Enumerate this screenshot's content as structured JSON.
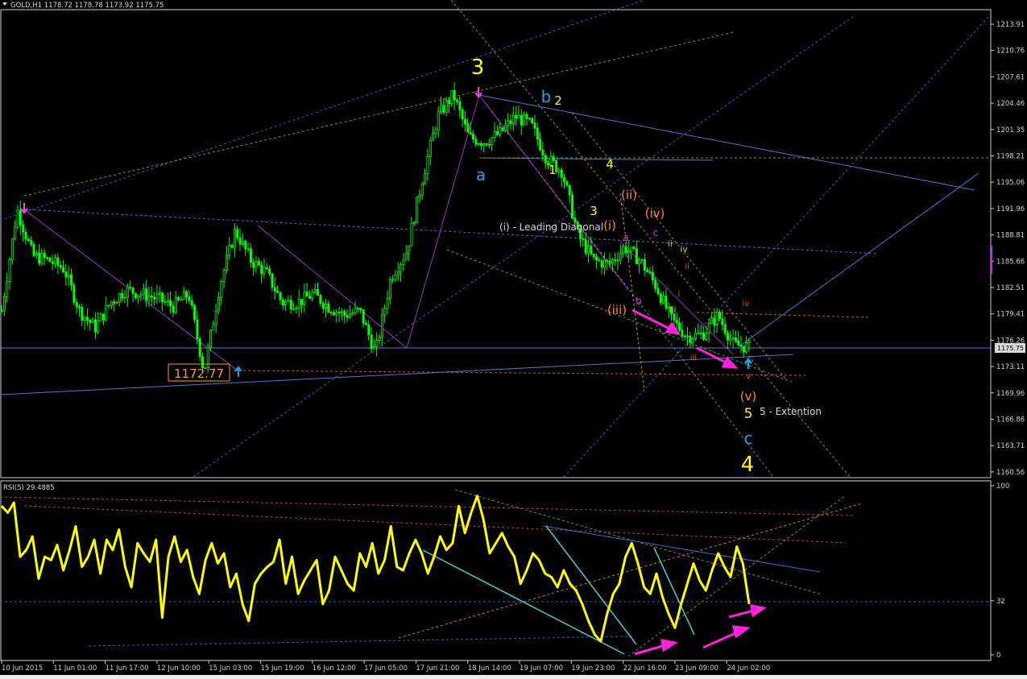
{
  "main_panel": {
    "header": "GOLD,H1  1178.72 1178.78 1173.92 1175.75",
    "price_ticks": [
      "1213.91",
      "1210.76",
      "1207.61",
      "1204.46",
      "1201.35",
      "1198.21",
      "1195.06",
      "1191.96",
      "1188.81",
      "1185.66",
      "1182.51",
      "1179.41",
      "1176.26",
      "1173.11",
      "1169.96",
      "1166.86",
      "1163.71",
      "1160.56"
    ],
    "current_price_tag": "1175.75",
    "low_price_label": "1172.77",
    "wave_labels": [
      {
        "text": "3",
        "color": "#ffff00"
      },
      {
        "text": "4",
        "color": "#ffff00"
      },
      {
        "text": "5",
        "color": "#ffff00"
      },
      {
        "text": "b",
        "color": "#19a4f0"
      },
      {
        "text": "a",
        "color": "#19a4f0"
      },
      {
        "text": "c",
        "color": "#19a4f0"
      },
      {
        "text": "2",
        "color": "#ffff00"
      },
      {
        "text": "1",
        "color": "#ffff00"
      },
      {
        "text": "4",
        "color": "#ffff00"
      },
      {
        "text": "3",
        "color": "#ffff00"
      },
      {
        "text": "(ii)",
        "color": "#ff8c00"
      },
      {
        "text": "(iv)",
        "color": "#ff8c00"
      },
      {
        "text": "(i)",
        "color": "#ff8c00"
      },
      {
        "text": "(iii)",
        "color": "#ff8c00"
      },
      {
        "text": "(v)",
        "color": "#ff8c00"
      },
      {
        "text": "(i) - Leading Diagonal",
        "color": "#d8d8d8"
      },
      {
        "text": "5 - Extention",
        "color": "#d8d8d8"
      },
      {
        "text": "a",
        "color": "#c83cc8"
      },
      {
        "text": "b",
        "color": "#c83cc8"
      },
      {
        "text": "c",
        "color": "#c83cc8"
      },
      {
        "text": "ii",
        "color": "#b5d82a"
      },
      {
        "text": "iv",
        "color": "#b5d82a"
      },
      {
        "text": "iii",
        "color": "#b5d82a"
      },
      {
        "text": "i",
        "color": "#ff4040"
      },
      {
        "text": "ii",
        "color": "#ff4040"
      },
      {
        "text": "iii",
        "color": "#ff4040"
      },
      {
        "text": "iv",
        "color": "#ff4040"
      },
      {
        "text": "v",
        "color": "#ff4040"
      }
    ]
  },
  "rsi_panel": {
    "header": "RSI(5) 29.4885",
    "ticks": [
      "100",
      "32",
      "0"
    ]
  },
  "x_ticks": [
    "10 Jun 2015",
    "11 Jun 01:00",
    "11 Jun 17:00",
    "12 Jun 10:00",
    "15 Jun 03:00",
    "15 Jun 19:00",
    "16 Jun 12:00",
    "17 Jun 05:00",
    "17 Jun 21:00",
    "18 Jun 14:00",
    "19 Jun 07:00",
    "19 Jun 23:00",
    "22 Jun 16:00",
    "23 Jun 09:00",
    "24 Jun 02:00"
  ],
  "colors": {
    "background": "#000000",
    "candle_up": "#00ff00",
    "candle_down": "#00ff00",
    "rsi_line": "#ffff00",
    "arrow_magenta": "#ff00ff",
    "trendline_blue": "#4169e1",
    "fib_green": "#6b8e23"
  },
  "chart_data": [
    {
      "type": "line",
      "subtype": "candlestick",
      "symbol": "GOLD",
      "timeframe": "H1",
      "ohlc_last": {
        "open": 1178.72,
        "high": 1178.78,
        "low": 1173.92,
        "close": 1175.75
      },
      "ylim": [
        1160.56,
        1213.91
      ],
      "x_tick_labels": [
        "10 Jun 2015",
        "11 Jun 01:00",
        "11 Jun 17:00",
        "12 Jun 10:00",
        "15 Jun 03:00",
        "15 Jun 19:00",
        "16 Jun 12:00",
        "17 Jun 05:00",
        "17 Jun 21:00",
        "18 Jun 14:00",
        "19 Jun 07:00",
        "19 Jun 23:00",
        "22 Jun 16:00",
        "23 Jun 09:00",
        "24 Jun 02:00"
      ],
      "close_path": [
        1180.0,
        1192.0,
        1186.5,
        1186.0,
        1185.0,
        1180.0,
        1178.0,
        1181.0,
        1182.5,
        1182.0,
        1181.5,
        1180.5,
        1182.0,
        1172.77,
        1183.0,
        1189.5,
        1186.0,
        1184.5,
        1181.0,
        1181.0,
        1182.0,
        1180.5,
        1179.5,
        1180.0,
        1175.0,
        1184.0,
        1187.0,
        1195.5,
        1203.0,
        1205.6,
        1200.5,
        1200.0,
        1201.0,
        1203.0,
        1202.0,
        1198.0,
        1196.5,
        1189.0,
        1186.0,
        1185.5,
        1187.5,
        1186.0,
        1183.0,
        1179.0,
        1177.0,
        1177.2,
        1179.5,
        1176.0,
        1175.75
      ],
      "key_levels": {
        "swing_high": 1205.6,
        "swing_low": 1172.77,
        "current": 1175.75
      }
    },
    {
      "type": "line",
      "title": "RSI(5) 29.4885",
      "ylim": [
        0,
        100
      ],
      "levels": [
        32
      ],
      "series": [
        {
          "values": [
            88,
            84,
            90,
            58,
            62,
            70,
            45,
            58,
            56,
            65,
            50,
            62,
            76,
            52,
            58,
            68,
            48,
            68,
            62,
            74,
            52,
            40,
            66,
            60,
            55,
            68,
            22,
            58,
            70,
            55,
            62,
            46,
            36,
            56,
            66,
            54,
            60,
            40,
            48,
            30,
            20,
            42,
            48,
            52,
            55,
            68,
            42,
            58,
            36,
            44,
            50,
            56,
            30,
            38,
            58,
            50,
            42,
            38,
            60,
            52,
            66,
            48,
            56,
            76,
            52,
            50,
            60,
            68,
            60,
            48,
            58,
            70,
            62,
            66,
            88,
            72,
            84,
            94,
            80,
            60,
            66,
            72,
            64,
            58,
            42,
            50,
            60,
            56,
            48,
            46,
            40,
            50,
            42,
            38,
            30,
            20,
            12,
            8,
            24,
            36,
            42,
            58,
            66,
            54,
            40,
            36,
            48,
            34,
            24,
            16,
            30,
            42,
            54,
            44,
            38,
            50,
            60,
            52,
            46,
            64,
            54,
            30
          ]
        }
      ]
    }
  ]
}
